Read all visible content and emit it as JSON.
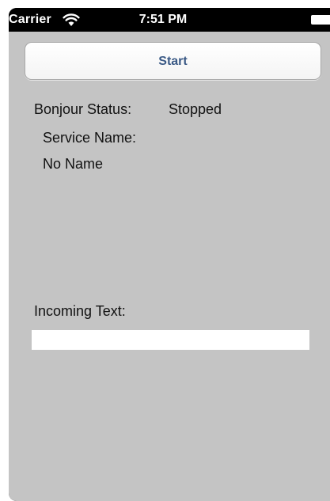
{
  "status_bar": {
    "carrier": "Carrier",
    "time": "7:51 PM",
    "wifi_icon": "wifi-icon",
    "battery_icon": "battery-icon"
  },
  "start_button": {
    "label": "Start"
  },
  "bonjour": {
    "label": "Bonjour Status:",
    "value": "Stopped"
  },
  "service": {
    "label": "Service Name:",
    "value": "No Name"
  },
  "incoming": {
    "label": "Incoming Text:",
    "value": ""
  },
  "colors": {
    "screen_background": "#c4c4c4",
    "button_text": "#3b5a86",
    "status_bar": "#000000"
  }
}
